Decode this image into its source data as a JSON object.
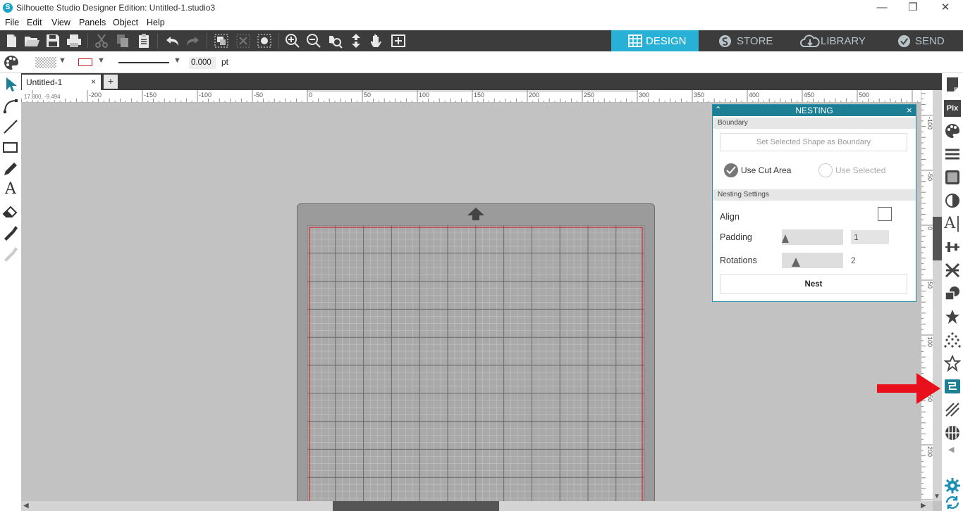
{
  "window": {
    "title": "Silhouette Studio Designer Edition: Untitled-1.studio3",
    "logo_letter": "S",
    "minimize": "—",
    "restore": "❐",
    "close": "✕"
  },
  "menu": [
    "File",
    "Edit",
    "View",
    "Panels",
    "Object",
    "Help"
  ],
  "nav_tabs": [
    {
      "label": "DESIGN",
      "icon": "grid-icon",
      "active": true
    },
    {
      "label": "STORE",
      "icon": "silhouette-s-icon",
      "active": false
    },
    {
      "label": "LIBRARY",
      "icon": "cloud-icon",
      "active": false
    },
    {
      "label": "SEND",
      "icon": "check-circle-icon",
      "active": false
    }
  ],
  "properties": {
    "line_width_value": "0.000",
    "line_width_unit": "pt",
    "accent_color": "#cc2233"
  },
  "document": {
    "tab_label": "Untitled-1",
    "tab_close": "×",
    "add_tab": "+",
    "cursor_readout": "17.800, -9.494"
  },
  "ruler": {
    "h_labels": [
      "-200",
      "-150",
      "-100",
      "-50",
      "0",
      "50",
      "100",
      "150",
      "200",
      "250",
      "300",
      "350",
      "400",
      "450",
      "500"
    ],
    "v_labels": [
      "-100",
      "-50",
      "0",
      "50",
      "100",
      "150",
      "200"
    ]
  },
  "nesting_panel": {
    "title": "NESTING",
    "collapse_icon": "chevron-up-icon",
    "close": "×",
    "boundary_header": "Boundary",
    "set_boundary_button": "Set Selected Shape as Boundary",
    "use_cut_area": "Use Cut Area",
    "use_cut_area_selected": true,
    "use_selected": "Use Selected",
    "settings_header": "Nesting Settings",
    "align_label": "Align",
    "align_checked": false,
    "padding_label": "Padding",
    "padding_value": "1",
    "rotations_label": "Rotations",
    "rotations_value": "2",
    "nest_button": "Nest"
  },
  "colors": {
    "accent_blue": "#28b1d6",
    "panel_header": "#1d7f94",
    "toolbar": "#3c3c3c",
    "arrow_red": "#e8101a"
  }
}
